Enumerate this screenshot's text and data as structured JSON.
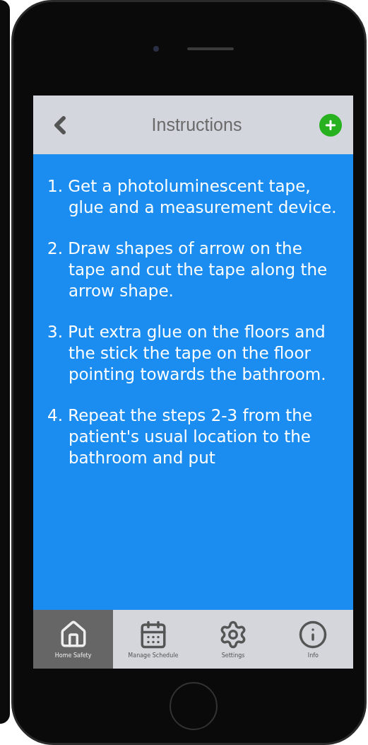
{
  "header": {
    "title": "Instructions"
  },
  "steps": [
    "1. Get a photoluminescent tape, glue and a measurement  device.",
    "2. Draw shapes of arrow on the tape and cut the tape along the arrow shape.",
    "3. Put extra glue on the floors and the stick the tape on the floor pointing towards the bathroom.",
    "4. Repeat the steps 2-3 from the patient's usual location to the bathroom and put"
  ],
  "tabs": [
    {
      "kind": "home",
      "label": "Home Safety",
      "selected": true
    },
    {
      "kind": "calendar",
      "label": "Manage Schedule",
      "selected": false
    },
    {
      "kind": "settings",
      "label": "Settings",
      "selected": false
    },
    {
      "kind": "info",
      "label": "Info",
      "selected": false
    }
  ]
}
